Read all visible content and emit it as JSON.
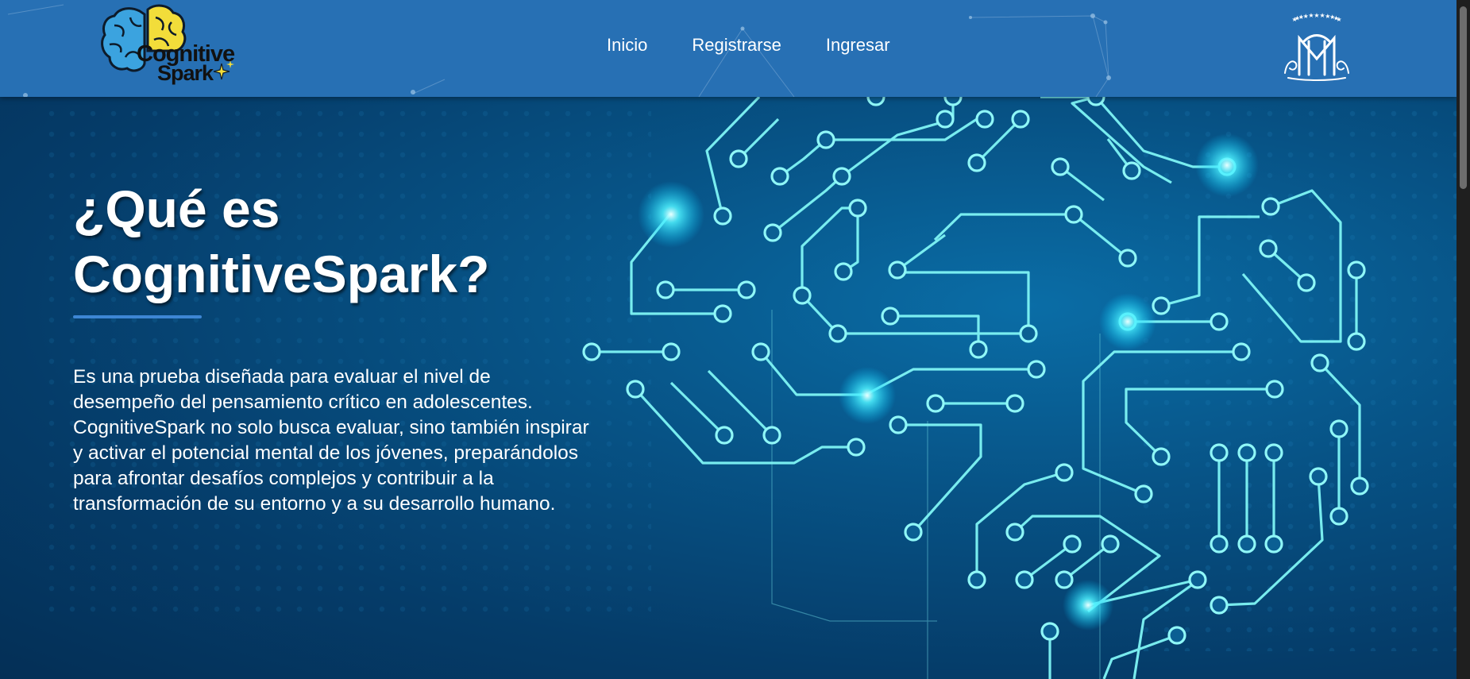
{
  "logo": {
    "line1": "Cognitive",
    "line2": "Spark"
  },
  "nav": {
    "items": [
      "Inicio",
      "Registrarse",
      "Ingresar"
    ]
  },
  "hero": {
    "title": "¿Qué es CognitiveSpark?",
    "description": "Es una prueba diseñada para evaluar el nivel de desempeño del pensamiento crítico en adolescentes. CognitiveSpark no solo busca evaluar, sino también inspirar y activar el potencial mental de los jóvenes, preparándolos para afrontar desafíos complejos y contribuir a la transformación de su entorno y a su desarrollo humano."
  },
  "colors": {
    "navbar": "#2770b4",
    "circuit": "#7ff5f5",
    "accent": "#3d86d4"
  },
  "icons": {
    "logo": "brain-logo-icon",
    "crest": "crest-monogram-icon"
  }
}
